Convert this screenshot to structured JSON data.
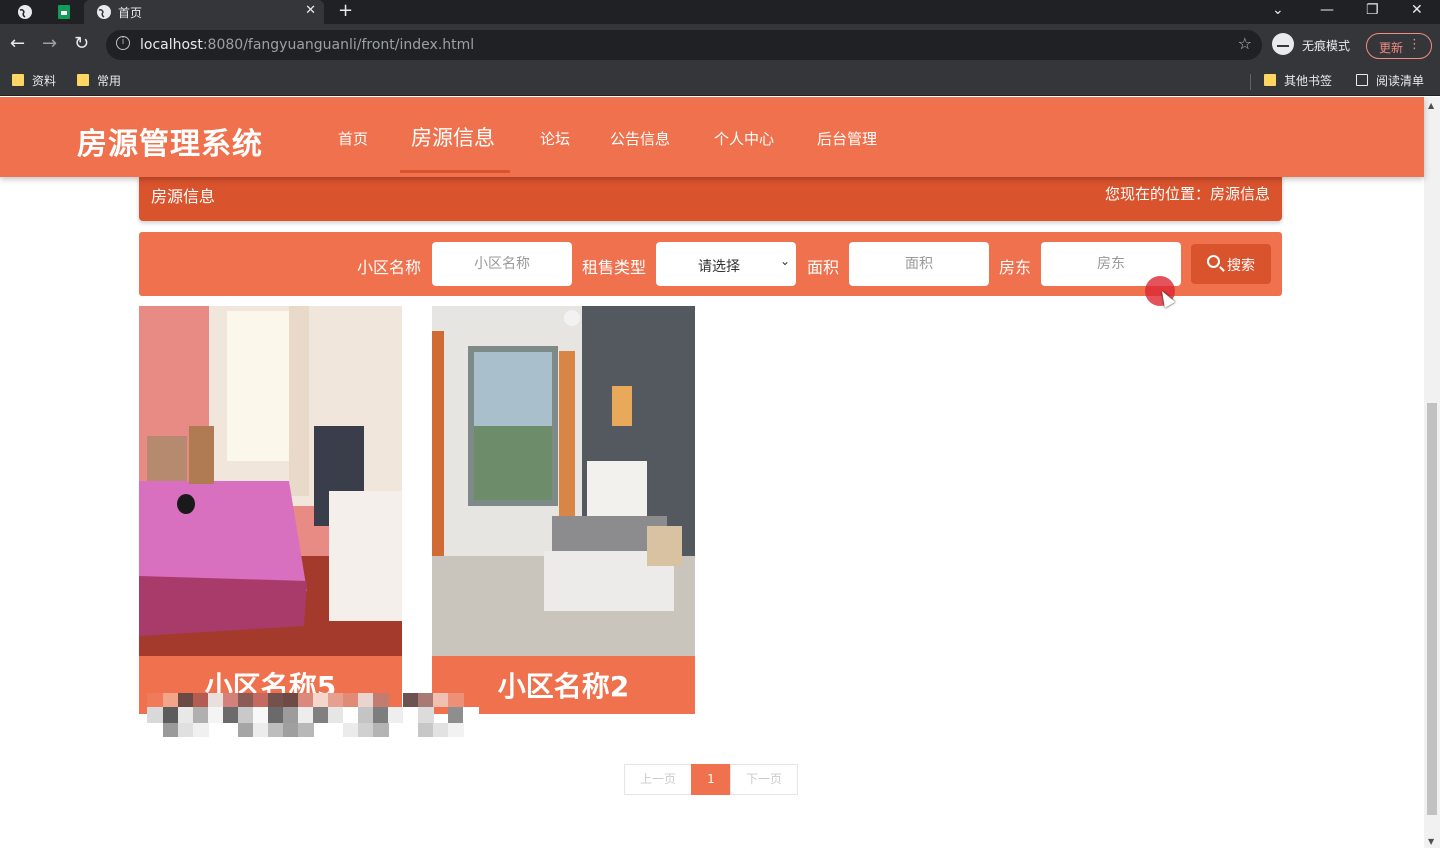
{
  "browser": {
    "tab_title": "首页",
    "url_host": "localhost",
    "url_path": ":8080/fangyuanguanli/front/index.html",
    "incognito_label": "无痕模式",
    "update_label": "更新",
    "bookmarks": [
      "资料",
      "常用"
    ],
    "other_bookmarks": "其他书签",
    "reading_list": "阅读清单"
  },
  "header": {
    "site_title": "房源管理系统",
    "nav": [
      "首页",
      "房源信息",
      "论坛",
      "公告信息",
      "个人中心",
      "后台管理"
    ],
    "active_nav": "房源信息"
  },
  "breadcrumb": {
    "title": "房源信息",
    "location": "您现在的位置：房源信息"
  },
  "search": {
    "community_label": "小区名称",
    "community_placeholder": "小区名称",
    "type_label": "租售类型",
    "type_selected": "请选择",
    "area_label": "面积",
    "area_placeholder": "面积",
    "landlord_label": "房东",
    "landlord_placeholder": "房东",
    "button_label": "搜索"
  },
  "listings": [
    {
      "name": "小区名称5"
    },
    {
      "name": "小区名称2"
    }
  ],
  "pagination": {
    "prev": "上一页",
    "current": "1",
    "next": "下一页"
  },
  "colors": {
    "primary": "#ef714d",
    "dark": "#d9532d"
  }
}
